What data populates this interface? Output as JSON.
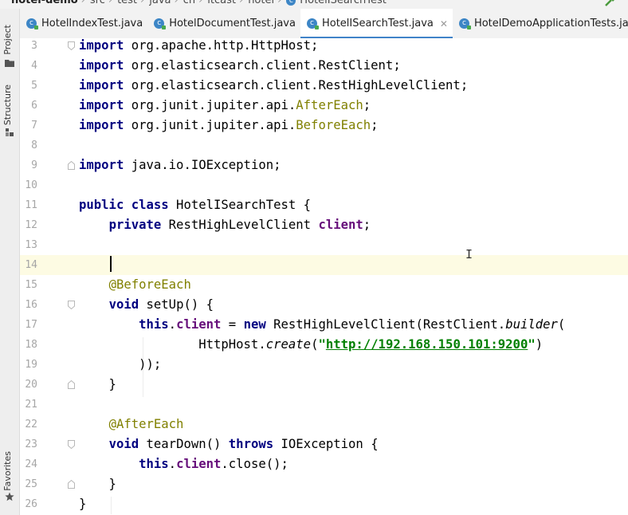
{
  "breadcrumb": {
    "items": [
      "hotel-demo",
      "src",
      "test",
      "java",
      "cn",
      "itcast",
      "hotel",
      "HotelISearchTest"
    ]
  },
  "sidebar": {
    "project_label": "Project",
    "structure_label": "Structure",
    "favorites_label": "Favorites"
  },
  "tabs": [
    {
      "label": "HotelIndexTest.java",
      "active": false
    },
    {
      "label": "HotelDocumentTest.java",
      "active": false
    },
    {
      "label": "HotelISearchTest.java",
      "active": true
    },
    {
      "label": "HotelDemoApplicationTests.java",
      "active": false
    }
  ],
  "editor": {
    "current_line": 14,
    "lines": [
      {
        "n": "3",
        "t": [
          [
            "kw",
            "import"
          ],
          [
            "p",
            " org.apache.http.HttpHost;"
          ]
        ]
      },
      {
        "n": "4",
        "t": [
          [
            "kw",
            "import"
          ],
          [
            "p",
            " org.elasticsearch.client.RestClient;"
          ]
        ]
      },
      {
        "n": "5",
        "t": [
          [
            "kw",
            "import"
          ],
          [
            "p",
            " org.elasticsearch.client.RestHighLevelClient;"
          ]
        ]
      },
      {
        "n": "6",
        "t": [
          [
            "kw",
            "import"
          ],
          [
            "p",
            " org.junit.jupiter.api."
          ],
          [
            "ann",
            "AfterEach"
          ],
          [
            "p",
            ";"
          ]
        ]
      },
      {
        "n": "7",
        "t": [
          [
            "kw",
            "import"
          ],
          [
            "p",
            " org.junit.jupiter.api."
          ],
          [
            "ann",
            "BeforeEach"
          ],
          [
            "p",
            ";"
          ]
        ]
      },
      {
        "n": "8",
        "t": []
      },
      {
        "n": "9",
        "t": [
          [
            "kw",
            "import"
          ],
          [
            "p",
            " java.io.IOException;"
          ]
        ]
      },
      {
        "n": "10",
        "t": []
      },
      {
        "n": "11",
        "t": [
          [
            "kw",
            "public class"
          ],
          [
            "p",
            " HotelISearchTest {"
          ]
        ]
      },
      {
        "n": "12",
        "t": [
          [
            "p",
            "    "
          ],
          [
            "kw",
            "private"
          ],
          [
            "p",
            " RestHighLevelClient "
          ],
          [
            "fld",
            "client"
          ],
          [
            "p",
            ";"
          ]
        ]
      },
      {
        "n": "13",
        "t": []
      },
      {
        "n": "14",
        "t": []
      },
      {
        "n": "15",
        "t": [
          [
            "p",
            "    "
          ],
          [
            "ann",
            "@BeforeEach"
          ]
        ]
      },
      {
        "n": "16",
        "t": [
          [
            "p",
            "    "
          ],
          [
            "kw",
            "void"
          ],
          [
            "p",
            " setUp() {"
          ]
        ]
      },
      {
        "n": "17",
        "t": [
          [
            "p",
            "        "
          ],
          [
            "kw",
            "this"
          ],
          [
            "p",
            "."
          ],
          [
            "fld",
            "client"
          ],
          [
            "p",
            " = "
          ],
          [
            "kw",
            "new"
          ],
          [
            "p",
            " RestHighLevelClient(RestClient."
          ],
          [
            "ital",
            "builder"
          ],
          [
            "p",
            "("
          ]
        ]
      },
      {
        "n": "18",
        "t": [
          [
            "p",
            "                HttpHost."
          ],
          [
            "ital",
            "create"
          ],
          [
            "p",
            "("
          ],
          [
            "str",
            "\""
          ],
          [
            "strlink",
            "http://192.168.150.101:9200"
          ],
          [
            "str",
            "\""
          ],
          [
            "p",
            ")"
          ]
        ]
      },
      {
        "n": "19",
        "t": [
          [
            "p",
            "        ));"
          ]
        ]
      },
      {
        "n": "20",
        "t": [
          [
            "p",
            "    }"
          ]
        ]
      },
      {
        "n": "21",
        "t": []
      },
      {
        "n": "22",
        "t": [
          [
            "p",
            "    "
          ],
          [
            "ann",
            "@AfterEach"
          ]
        ]
      },
      {
        "n": "23",
        "t": [
          [
            "p",
            "    "
          ],
          [
            "kw",
            "void"
          ],
          [
            "p",
            " tearDown() "
          ],
          [
            "kw",
            "throws"
          ],
          [
            "p",
            " IOException {"
          ]
        ]
      },
      {
        "n": "24",
        "t": [
          [
            "p",
            "        "
          ],
          [
            "kw",
            "this"
          ],
          [
            "p",
            "."
          ],
          [
            "fld",
            "client"
          ],
          [
            "p",
            ".close();"
          ]
        ]
      },
      {
        "n": "25",
        "t": [
          [
            "p",
            "    }"
          ]
        ]
      },
      {
        "n": "26",
        "t": [
          [
            "p",
            "}"
          ]
        ]
      }
    ]
  },
  "colors": {
    "keyword": "#000080",
    "annotation": "#808000",
    "field": "#660e7a",
    "string": "#008000",
    "current_line": "#fdfbe3",
    "active_tab_underline": "#4083c9"
  },
  "icons": {
    "tab_file": "java-class-icon",
    "toolbar": "hammer-build-icon",
    "favorites": "star-icon"
  }
}
